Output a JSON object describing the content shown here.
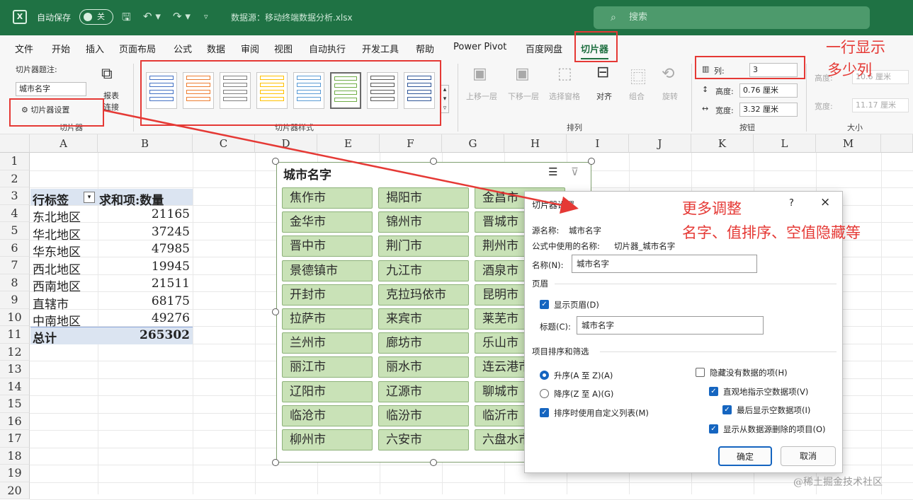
{
  "titlebar": {
    "app_icon": "X",
    "autosave_label": "自动保存",
    "toggle_label": "关",
    "save_icon": "save-icon",
    "undo_icon": "undo-icon",
    "redo_icon": "redo-icon",
    "filename": "数据源：移动终端数据分析.xlsx",
    "search_placeholder": "搜索"
  },
  "menu": {
    "tabs": [
      "文件",
      "开始",
      "插入",
      "页面布局",
      "公式",
      "数据",
      "审阅",
      "视图",
      "自动执行",
      "开发工具",
      "帮助",
      "Power Pivot",
      "百度网盘",
      "切片器"
    ],
    "active": "切片器"
  },
  "ribbon": {
    "caption_label": "切片器题注:",
    "caption_value": "城市名字",
    "settings_label": "切片器设置",
    "report_label_1": "报表",
    "report_label_2": "连接",
    "group_slicer": "切片器",
    "group_styles": "切片器样式",
    "arrange_buttons": [
      "上移一层",
      "下移一层",
      "选择窗格",
      "对齐",
      "组合",
      "旋转"
    ],
    "group_arrange": "排列",
    "columns_label": "列:",
    "columns_value": "3",
    "height_label": "高度:",
    "height_value": "0.76 厘米",
    "width_label": "宽度:",
    "width_value": "3.32 厘米",
    "group_buttons": "按钮",
    "size_height_label": "高度:",
    "size_height_value": "10.6 厘米",
    "size_width_label": "宽度:",
    "size_width_value": "11.17 厘米",
    "group_size": "大小"
  },
  "annotations": {
    "columns_note_1": "一行显示",
    "columns_note_2": "多少列",
    "dialog_note_1": "更多调整",
    "dialog_note_2": "名字、值排序、空值隐藏等"
  },
  "grid": {
    "columns": [
      "A",
      "B",
      "C",
      "D",
      "E",
      "F",
      "G",
      "H",
      "I",
      "J",
      "K",
      "L",
      "M"
    ],
    "rows": [
      "1",
      "2",
      "3",
      "4",
      "5",
      "6",
      "7",
      "8",
      "9",
      "10",
      "11",
      "12",
      "13",
      "14",
      "15",
      "16",
      "17",
      "18",
      "19",
      "20"
    ],
    "pivot_header_label": "行标签",
    "pivot_header_value": "求和项:数量",
    "pivot_rows": [
      {
        "label": "东北地区",
        "value": "21165"
      },
      {
        "label": "华北地区",
        "value": "37245"
      },
      {
        "label": "华东地区",
        "value": "47985"
      },
      {
        "label": "西北地区",
        "value": "19945"
      },
      {
        "label": "西南地区",
        "value": "21511"
      },
      {
        "label": "直辖市",
        "value": "68175"
      },
      {
        "label": "中南地区",
        "value": "49276"
      }
    ],
    "total_label": "总计",
    "total_value": "265302"
  },
  "slicer": {
    "title": "城市名字",
    "items": [
      "焦作市",
      "揭阳市",
      "金昌市",
      "金华市",
      "锦州市",
      "晋城市",
      "晋中市",
      "荆门市",
      "荆州市",
      "景德镇市",
      "九江市",
      "酒泉市",
      "开封市",
      "克拉玛依市",
      "昆明市",
      "拉萨市",
      "来宾市",
      "莱芜市",
      "兰州市",
      "廊坊市",
      "乐山市",
      "丽江市",
      "丽水市",
      "连云港市",
      "辽阳市",
      "辽源市",
      "聊城市",
      "临沧市",
      "临汾市",
      "临沂市",
      "柳州市",
      "六安市",
      "六盘水市"
    ]
  },
  "dialog": {
    "title": "切片器设置",
    "help": "?",
    "close": "×",
    "source_name_label": "源名称:",
    "source_name": "城市名字",
    "formula_name_label": "公式中使用的名称:",
    "formula_name": "切片器_城市名字",
    "name_label": "名称(N):",
    "name_value": "城市名字",
    "header_section": "页眉",
    "show_header": "显示页眉(D)",
    "caption_label": "标题(C):",
    "caption_value": "城市名字",
    "sort_section": "项目排序和筛选",
    "ascending": "升序(A 至 Z)(A)",
    "descending": "降序(Z 至 A)(G)",
    "custom_lists": "排序时使用自定义列表(M)",
    "hide_no_data": "隐藏没有数据的项(H)",
    "indicate_no_data": "直观地指示空数据项(V)",
    "show_no_data_last": "最后显示空数据项(I)",
    "show_deleted": "显示从数据源删除的项目(O)",
    "ok": "确定",
    "cancel": "取消"
  },
  "watermark": "@稀土掘金技术社区"
}
